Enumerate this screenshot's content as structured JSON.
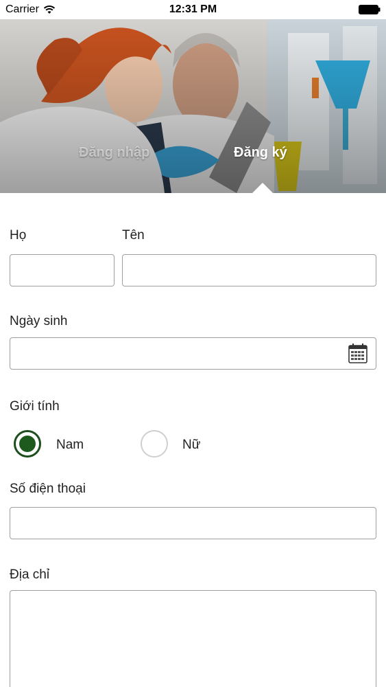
{
  "status_bar": {
    "carrier": "Carrier",
    "time": "12:31 PM"
  },
  "header": {
    "tabs": [
      {
        "label": "Đăng nhập",
        "active": false
      },
      {
        "label": "Đăng ký",
        "active": true
      }
    ]
  },
  "form": {
    "last_name_label": "Họ",
    "first_name_label": "Tên",
    "birthdate_label": "Ngày sinh",
    "gender_label": "Giới tính",
    "gender_options": [
      {
        "label": "Nam",
        "selected": true
      },
      {
        "label": "Nữ",
        "selected": false
      }
    ],
    "phone_label": "Số điện thoại",
    "address_label": "Địa chỉ"
  },
  "colors": {
    "accent": "#1e5a1e",
    "field_border": "#9e9e9e"
  }
}
